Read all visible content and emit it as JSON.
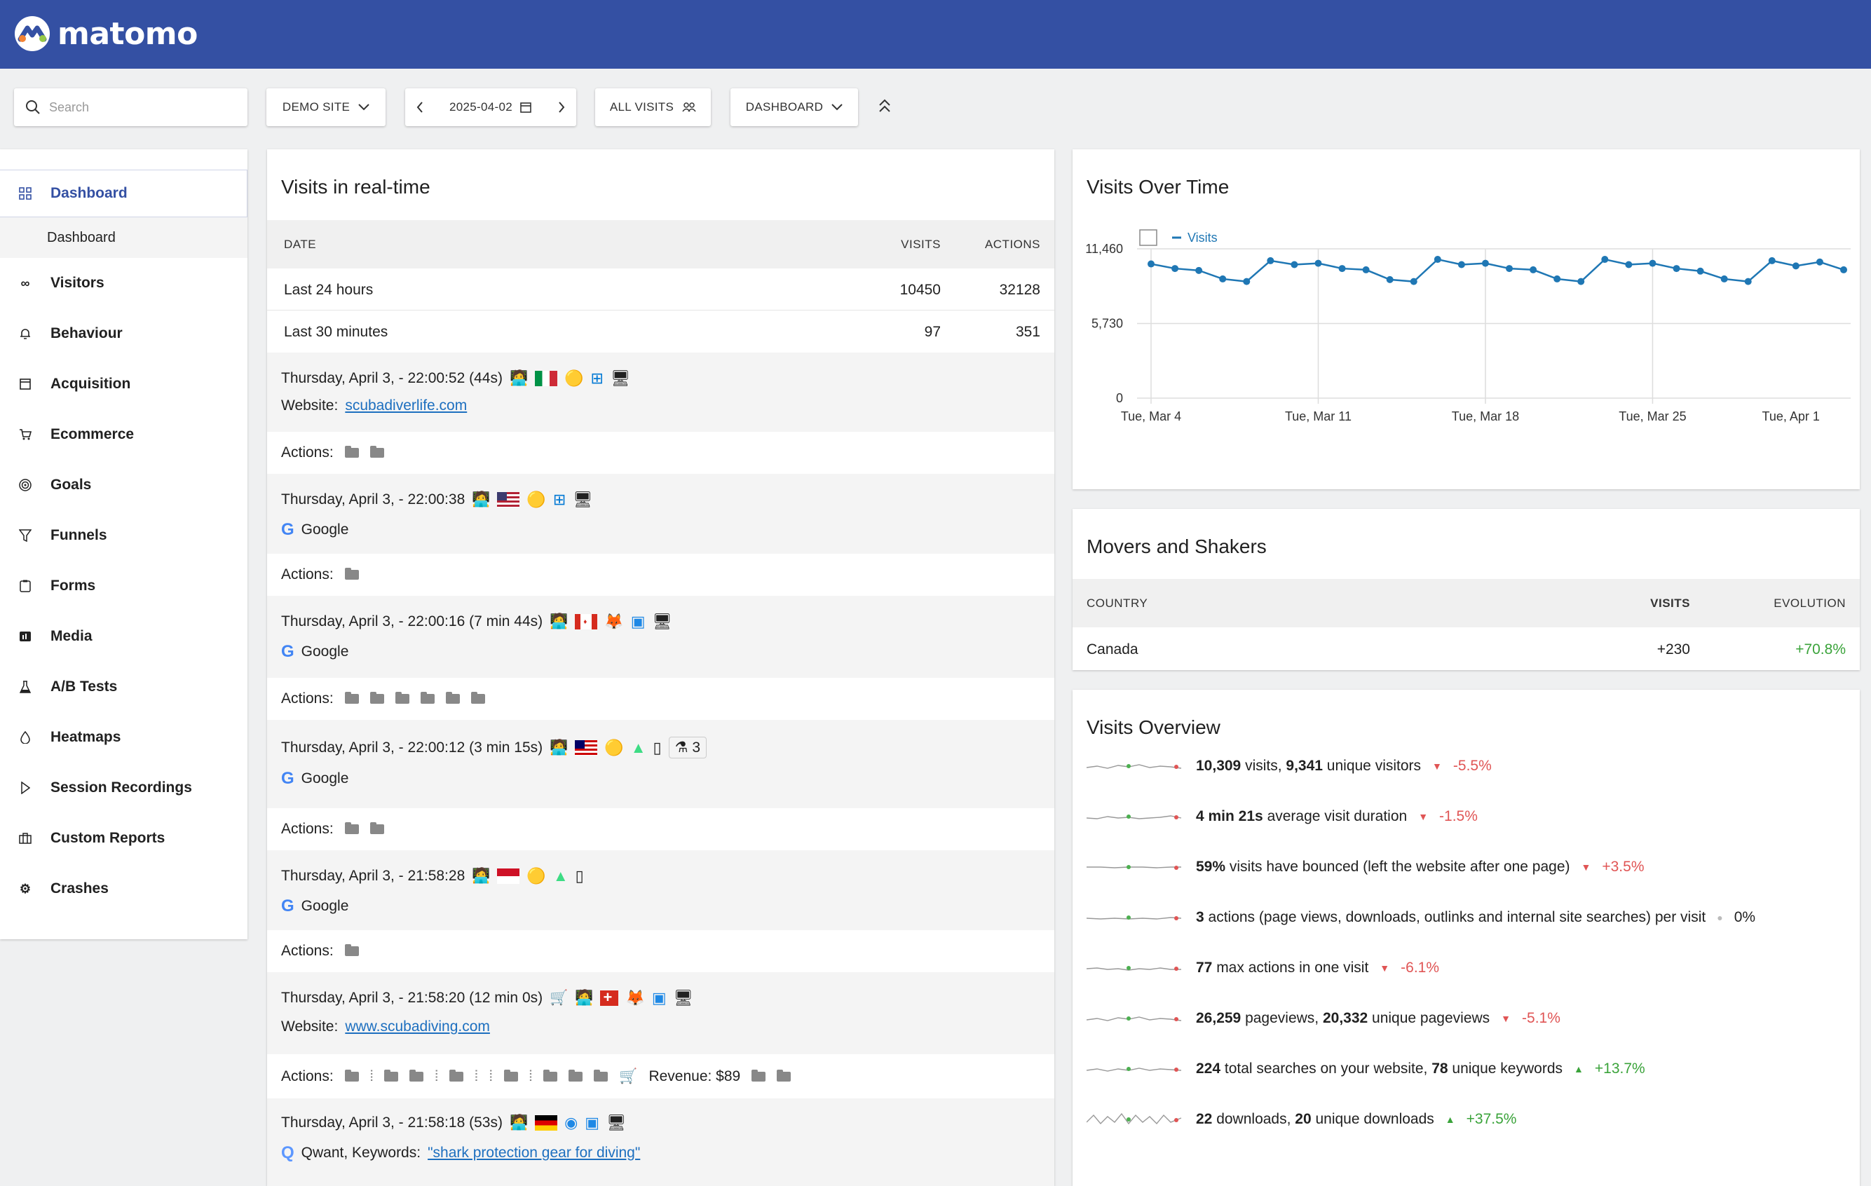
{
  "app": {
    "name": "matomo"
  },
  "toolbar": {
    "search_placeholder": "Search",
    "site": "DEMO SITE",
    "date": "2025-04-02",
    "segment": "ALL VISITS",
    "dashboard": "DASHBOARD"
  },
  "sidebar": {
    "items": [
      {
        "label": "Dashboard",
        "icon": "grid-icon"
      },
      {
        "label": "Dashboard",
        "icon": ""
      },
      {
        "label": "Visitors",
        "icon": "glasses-icon"
      },
      {
        "label": "Behaviour",
        "icon": "bell-icon"
      },
      {
        "label": "Acquisition",
        "icon": "window-icon"
      },
      {
        "label": "Ecommerce",
        "icon": "cart-icon"
      },
      {
        "label": "Goals",
        "icon": "target-icon"
      },
      {
        "label": "Funnels",
        "icon": "funnel-icon"
      },
      {
        "label": "Forms",
        "icon": "clipboard-icon"
      },
      {
        "label": "Media",
        "icon": "media-icon"
      },
      {
        "label": "A/B Tests",
        "icon": "flask-icon"
      },
      {
        "label": "Heatmaps",
        "icon": "drop-icon"
      },
      {
        "label": "Session Recordings",
        "icon": "play-icon"
      },
      {
        "label": "Custom Reports",
        "icon": "briefcase-icon"
      },
      {
        "label": "Crashes",
        "icon": "bug-icon"
      }
    ]
  },
  "realtime": {
    "title": "Visits in real-time",
    "col_date": "DATE",
    "col_visits": "VISITS",
    "col_actions": "ACTIONS",
    "rows": [
      {
        "label": "Last 24 hours",
        "visits": "10450",
        "actions": "32128"
      },
      {
        "label": "Last 30 minutes",
        "visits": "97",
        "actions": "351"
      }
    ],
    "visits": [
      {
        "time": "Thursday, April 3, - 22:00:52 (44s)",
        "source_prefix": "Website:",
        "source": "scubadiverlife.com",
        "actions_label": "Actions:",
        "revenue": "",
        "keyword": ""
      },
      {
        "time": "Thursday, April 3, - 22:00:38",
        "source_prefix": "",
        "source": "Google",
        "actions_label": "Actions:",
        "revenue": "",
        "keyword": ""
      },
      {
        "time": "Thursday, April 3, - 22:00:16 (7 min 44s)",
        "source_prefix": "",
        "source": "Google",
        "actions_label": "Actions:",
        "revenue": "",
        "keyword": ""
      },
      {
        "time": "Thursday, April 3, - 22:00:12 (3 min 15s)",
        "source_prefix": "",
        "source": "Google",
        "actions_label": "Actions:",
        "revenue": "",
        "keyword": "",
        "badge": "3"
      },
      {
        "time": "Thursday, April 3, - 21:58:28",
        "source_prefix": "",
        "source": "Google",
        "actions_label": "Actions:",
        "revenue": "",
        "keyword": ""
      },
      {
        "time": "Thursday, April 3, - 21:58:20 (12 min 0s)",
        "source_prefix": "Website:",
        "source": "www.scubadiving.com",
        "actions_label": "Actions:",
        "revenue": "Revenue: $89",
        "keyword": ""
      },
      {
        "time": "Thursday, April 3, - 21:58:18 (53s)",
        "source_prefix": "Qwant, Keywords:",
        "source": "\"shark protection gear for diving\"",
        "actions_label": "",
        "revenue": "",
        "keyword": ""
      }
    ]
  },
  "vot": {
    "title": "Visits Over Time"
  },
  "chart_data": {
    "type": "line",
    "title": "Visits Over Time",
    "series": [
      {
        "name": "Visits",
        "values": [
          10300,
          9950,
          9800,
          9150,
          8950,
          10550,
          10250,
          10350,
          9950,
          9850,
          9100,
          8950,
          10650,
          10250,
          10350,
          9950,
          9850,
          9150,
          8950,
          10650,
          10250,
          10350,
          9950,
          9750,
          9150,
          8950,
          10550,
          10150,
          10450,
          9850
        ]
      }
    ],
    "x_ticks": [
      "Tue, Mar 4",
      "Tue, Mar 11",
      "Tue, Mar 18",
      "Tue, Mar 25",
      "Tue, Apr 1"
    ],
    "y_ticks": [
      "0",
      "5,730",
      "11,460"
    ],
    "ylim": [
      0,
      11460
    ],
    "grid": true,
    "legend": "top-left"
  },
  "movers": {
    "title": "Movers and Shakers",
    "col_country": "COUNTRY",
    "col_visits": "VISITS",
    "col_evolution": "EVOLUTION",
    "rows": [
      {
        "country": "Canada",
        "visits": "+230",
        "evolution": "+70.8%"
      }
    ]
  },
  "overview": {
    "title": "Visits Overview",
    "items": [
      {
        "b1": "10,309",
        "t1": " visits, ",
        "b2": "9,341",
        "t2": " unique visitors",
        "change": "-5.5%",
        "trend": "neg"
      },
      {
        "b1": "4 min 21s",
        "t1": " average visit duration",
        "b2": "",
        "t2": "",
        "change": "-1.5%",
        "trend": "neg"
      },
      {
        "b1": "59%",
        "t1": " visits have bounced (left the website after one page)",
        "b2": "",
        "t2": "",
        "change": "+3.5%",
        "trend": "neg"
      },
      {
        "b1": "3",
        "t1": " actions (page views, downloads, outlinks and internal site searches) per visit",
        "b2": "",
        "t2": "",
        "change": "0%",
        "trend": "zero"
      },
      {
        "b1": "77",
        "t1": " max actions in one visit",
        "b2": "",
        "t2": "",
        "change": "-6.1%",
        "trend": "neg"
      },
      {
        "b1": "26,259",
        "t1": " pageviews, ",
        "b2": "20,332",
        "t2": " unique pageviews",
        "change": "-5.1%",
        "trend": "neg"
      },
      {
        "b1": "224",
        "t1": " total searches on your website, ",
        "b2": "78",
        "t2": " unique keywords",
        "change": "+13.7%",
        "trend": "pos"
      },
      {
        "b1": "22",
        "t1": " downloads, ",
        "b2": "20",
        "t2": " unique downloads",
        "change": "+37.5%",
        "trend": "pos"
      }
    ]
  }
}
